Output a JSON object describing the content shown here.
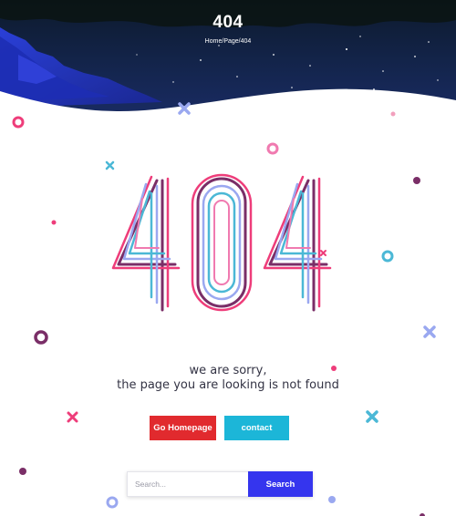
{
  "header": {
    "title": "404",
    "breadcrumb": {
      "home": "Home",
      "separator": "/",
      "section": "Page",
      "current": "404"
    }
  },
  "hero_graphic": "404",
  "message": {
    "line1": "we are sorry,",
    "line2": "the page you are looking is not found"
  },
  "buttons": {
    "home_label": "Go Homepage",
    "contact_label": "contact"
  },
  "search": {
    "placeholder": "Search...",
    "button_label": "Search"
  },
  "colors": {
    "night_sky": "#0b1732",
    "mountain_blue": "#2335c9",
    "go_homepage": "#e12a2e",
    "contact": "#1cb6d8",
    "search_button": "#3535ee",
    "confetti_pink": "#ee3d7a",
    "confetti_purple": "#7a2e67",
    "confetti_cyan": "#4bb8d6",
    "confetti_lavender": "#9aa8f0"
  }
}
